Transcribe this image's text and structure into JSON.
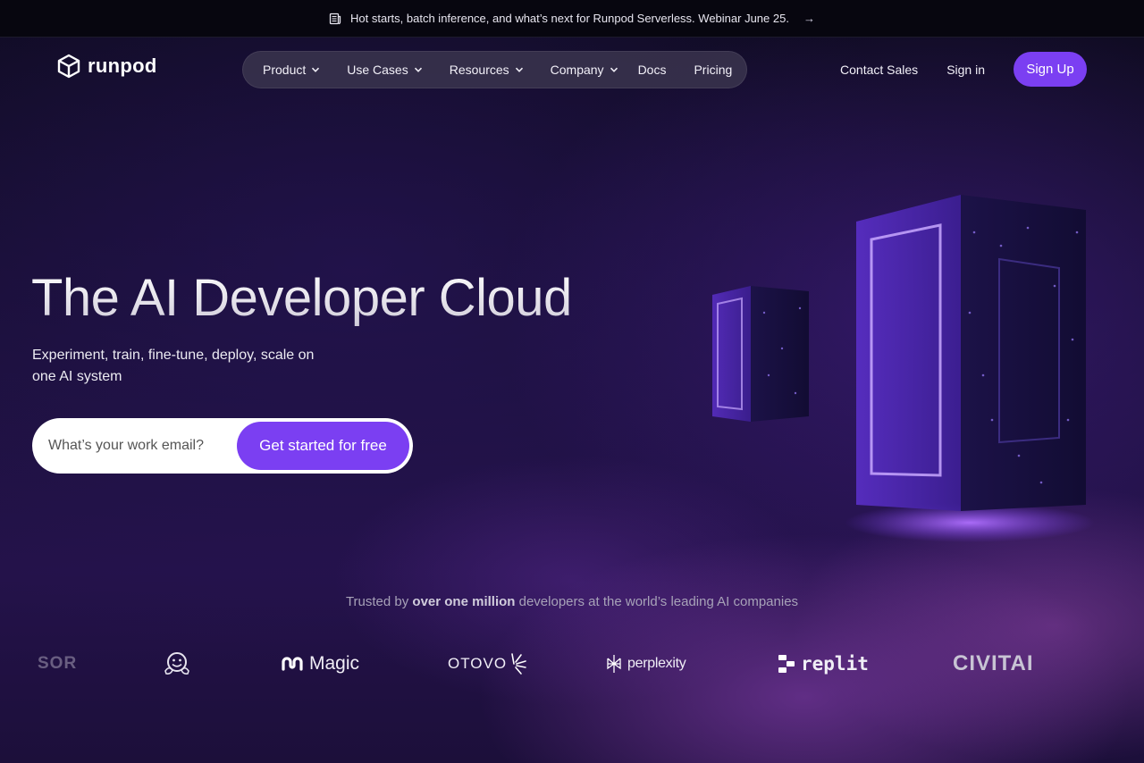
{
  "banner": {
    "icon": "newspaper-icon",
    "text": "Hot starts, batch inference, and what’s next for Runpod Serverless. Webinar June 25.",
    "arrow": "→"
  },
  "nav": {
    "brand": "runpod",
    "menu": [
      {
        "label": "Product",
        "dropdown": true
      },
      {
        "label": "Use Cases",
        "dropdown": true
      },
      {
        "label": "Resources",
        "dropdown": true
      },
      {
        "label": "Company",
        "dropdown": true
      },
      {
        "label": "Docs",
        "dropdown": false
      },
      {
        "label": "Pricing",
        "dropdown": false
      }
    ],
    "contact_sales": "Contact Sales",
    "sign_in": "Sign in",
    "sign_up": "Sign Up"
  },
  "hero": {
    "title": "The AI Developer Cloud",
    "subtitle": "Experiment, train, fine-tune, deploy, scale on one AI system",
    "email_placeholder": "What’s your work email?",
    "cta": "Get started for free"
  },
  "trusted": {
    "prefix": "Trusted by ",
    "highlight": "over one million",
    "suffix": " developers at the world’s leading AI companies"
  },
  "companies": [
    "SOR",
    "",
    "Magic",
    "OTOVO",
    "perplexity",
    "replit",
    "CIVITAI"
  ],
  "colors": {
    "accent": "#7b3ff2",
    "banner_bg": "#07060f",
    "menu_bg": "#3a344e"
  }
}
